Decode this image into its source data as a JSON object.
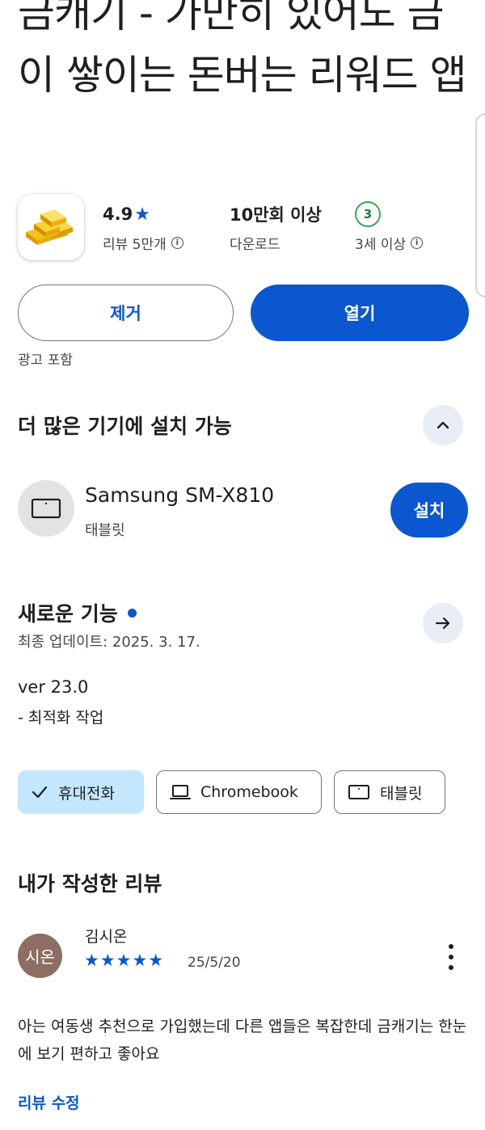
{
  "app": {
    "title": "금캐기 - 가만히 있어도 금이 쌓이는 돈버는 리워드 앱",
    "icon": "gold-bars-icon"
  },
  "stats": {
    "rating": "4.9",
    "reviews_label": "리뷰 5만개",
    "downloads": "10만회 이상",
    "downloads_label": "다운로드",
    "age_rating": "3",
    "age_label": "3세 이상"
  },
  "actions": {
    "remove": "제거",
    "open": "열기",
    "ads_note": "광고 포함"
  },
  "devices_section": {
    "title": "더 많은 기기에 설치 가능",
    "device_name": "Samsung SM-X810",
    "device_type": "태블릿",
    "install": "설치"
  },
  "whats_new": {
    "title": "새로운 기능",
    "updated": "최종 업데이트: 2025. 3. 17.",
    "version": "ver 23.0",
    "note": "- 최적화 작업"
  },
  "device_chips": {
    "phone": "휴대전화",
    "chromebook": "Chromebook",
    "tablet": "태블릿"
  },
  "my_review": {
    "title": "내가 작성한 리뷰",
    "avatar_text": "시온",
    "reviewer": "김시온",
    "stars": "★★★★★",
    "rating": 5,
    "date": "25/5/20",
    "text": "아는 여동생 추천으로 가입했는데 다른 앱들은 복잡한데 금캐기는 한눈에 보기 편하고 좋아요",
    "edit": "리뷰 수정"
  },
  "colors": {
    "primary": "#0b57d0",
    "chip_selected": "#c2e7ff",
    "age_green": "#34a853",
    "avatar_brown": "#8d6e63"
  }
}
